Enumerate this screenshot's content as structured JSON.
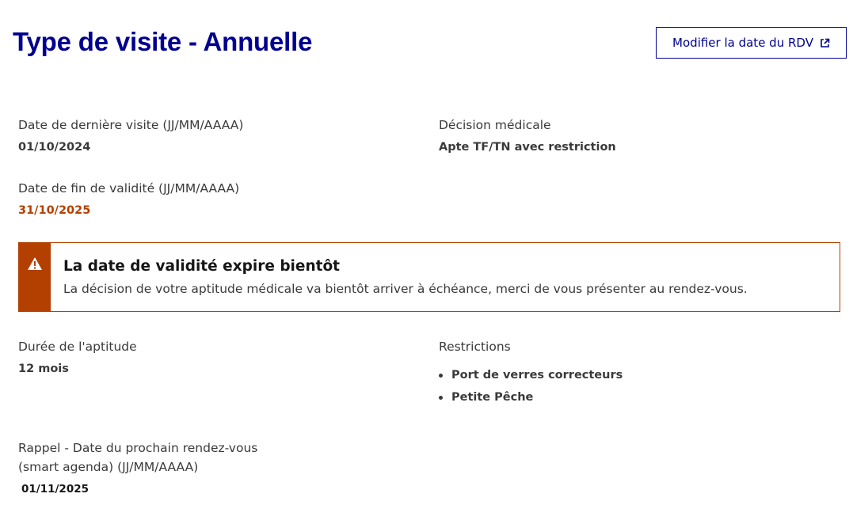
{
  "header": {
    "title": "Type de visite - Annuelle",
    "modify_button_label": "Modifier la date du RDV",
    "modify_button_icon": "external-link-icon"
  },
  "fields": {
    "last_visit": {
      "label": "Date de dernière visite (JJ/MM/AAAA)",
      "value": "01/10/2024"
    },
    "medical_decision": {
      "label": "Décision médicale",
      "value": "Apte TF/TN avec restriction"
    },
    "validity_end": {
      "label": "Date de fin de validité (JJ/MM/AAAA)",
      "value": "31/10/2025",
      "value_color": "#b34000"
    },
    "aptitude_duration": {
      "label": "Durée de l'aptitude",
      "value": "12 mois"
    },
    "restrictions": {
      "label": "Restrictions",
      "items": [
        "Port de verres correcteurs",
        "Petite Pêche"
      ]
    },
    "next_appointment": {
      "label_line1": "Rappel - Date du prochain rendez-vous",
      "label_line2": "(smart agenda) (JJ/MM/AAAA)",
      "value": "01/11/2025"
    }
  },
  "alert": {
    "icon": "warning-icon",
    "title": "La date de validité expire bientôt",
    "text": "La décision de votre aptitude médicale va bientôt arriver à échéance, merci de vous présenter au rendez-vous.",
    "color": "#b34000"
  },
  "colors": {
    "primary": "#000091",
    "warning": "#b34000",
    "text": "#3a3a3a"
  }
}
